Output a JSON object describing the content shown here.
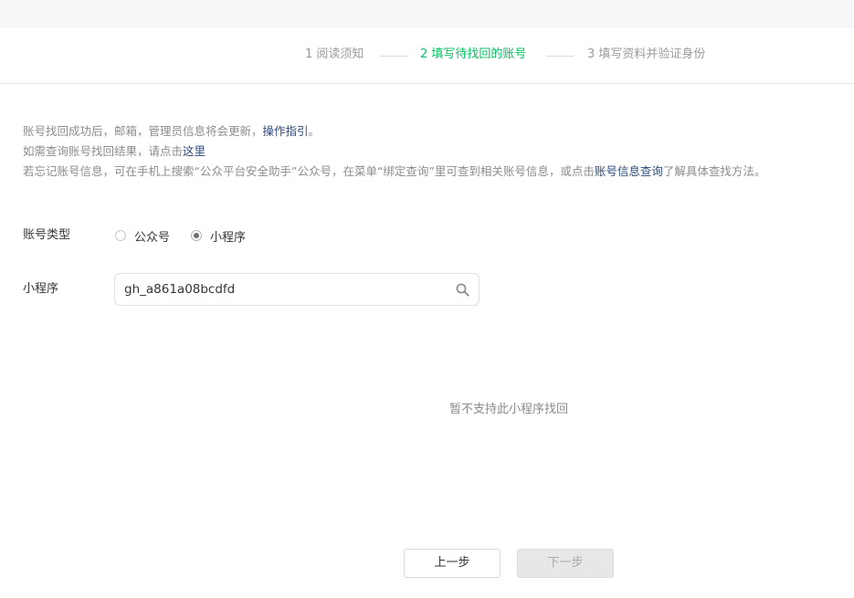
{
  "steps": [
    {
      "label": "1 阅读须知",
      "active": false
    },
    {
      "label": "2 填写待找回的账号",
      "active": true
    },
    {
      "label": "3 填写资料并验证身份",
      "active": false
    }
  ],
  "notice": {
    "line1_text": "账号找回成功后，邮箱，管理员信息将会更新，",
    "line1_link": "操作指引",
    "line1_end": "。",
    "line2_text": "如需查询账号找回结果，请点击",
    "line2_link": "这里",
    "line3_text": "若忘记账号信息，可在手机上搜索“公众平台安全助手”公众号，在菜单“绑定查询”里可查到相关账号信息，或点击",
    "line3_link": "账号信息查询",
    "line3_end": "了解具体查找方法。"
  },
  "form": {
    "account_type_label": "账号类型",
    "options": [
      {
        "label": "公众号",
        "checked": false
      },
      {
        "label": "小程序",
        "checked": true
      }
    ],
    "miniprogram_label": "小程序",
    "search_value": "gh_a861a08bcdfd"
  },
  "result_message": "暂不支持此小程序找回",
  "buttons": {
    "prev": "上一步",
    "next": "下一步"
  },
  "colors": {
    "active_step": "#07c160",
    "link": "#2f4a7a"
  }
}
